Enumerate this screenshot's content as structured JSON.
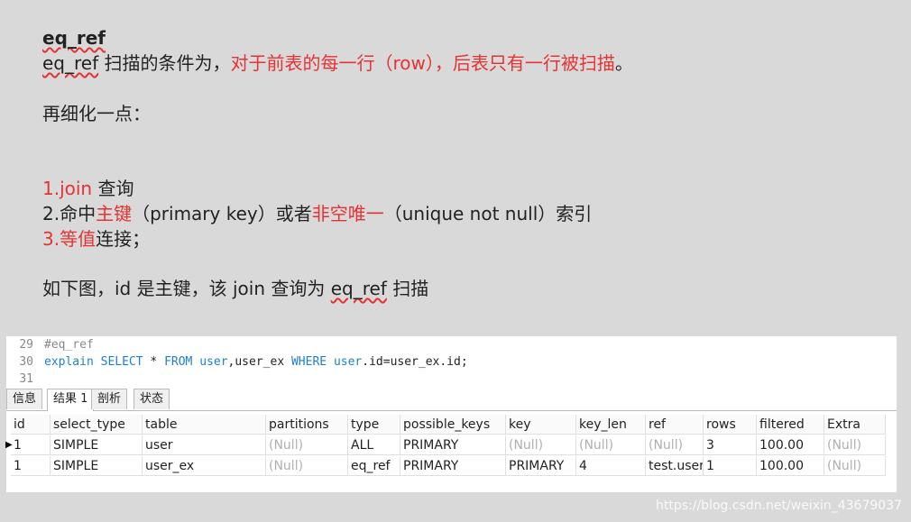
{
  "slide": {
    "heading": "eq_ref",
    "line1": {
      "term": "eq_ref",
      "mid": " 扫描的条件为，",
      "red": "对于前表的每一行（row），后表只有一行被扫描",
      "end": "。"
    },
    "line2": "再细化一点：",
    "item1": {
      "num_red": "1.join",
      "rest": " 查询"
    },
    "item2": {
      "prefix": "2.命中",
      "red1": "主键",
      "mid": "（primary key）或者",
      "red2": "非空唯一",
      "end": "（unique not null）索引"
    },
    "item3": {
      "red": "3.等值",
      "rest": "连接；"
    },
    "line_last": {
      "pre": "如下图，id 是主键，该 join 查询为 ",
      "term": "eq_ref",
      "post": " 扫描"
    }
  },
  "editor": {
    "lines": [
      {
        "num": "29",
        "comment": "#eq_ref"
      },
      {
        "num": "30",
        "tokens": [
          "explain",
          " SELECT",
          " * ",
          "FROM",
          " user",
          ",user_ex ",
          "WHERE",
          " user",
          ".id=user_ex.id;"
        ]
      },
      {
        "num": "31"
      }
    ]
  },
  "tabs": [
    "信息",
    "结果 1",
    "剖析",
    "状态"
  ],
  "table": {
    "columns": [
      "id",
      "select_type",
      "table",
      "partitions",
      "type",
      "possible_keys",
      "key",
      "key_len",
      "ref",
      "rows",
      "filtered",
      "Extra"
    ],
    "rows": [
      [
        "1",
        "SIMPLE",
        "user",
        "(Null)",
        "ALL",
        "PRIMARY",
        "(Null)",
        "(Null)",
        "(Null)",
        "3",
        "100.00",
        "(Null)"
      ],
      [
        "1",
        "SIMPLE",
        "user_ex",
        "(Null)",
        "eq_ref",
        "PRIMARY",
        "PRIMARY",
        "4",
        "test.user.",
        "1",
        "100.00",
        "(Null)"
      ]
    ],
    "row_marker": "▶"
  },
  "watermark": "https://blog.csdn.net/weixin_43679037",
  "colors": {
    "accent_red": "#e53333",
    "keyword_blue": "#1c7fd6",
    "null_gray": "#b0b0b0"
  }
}
